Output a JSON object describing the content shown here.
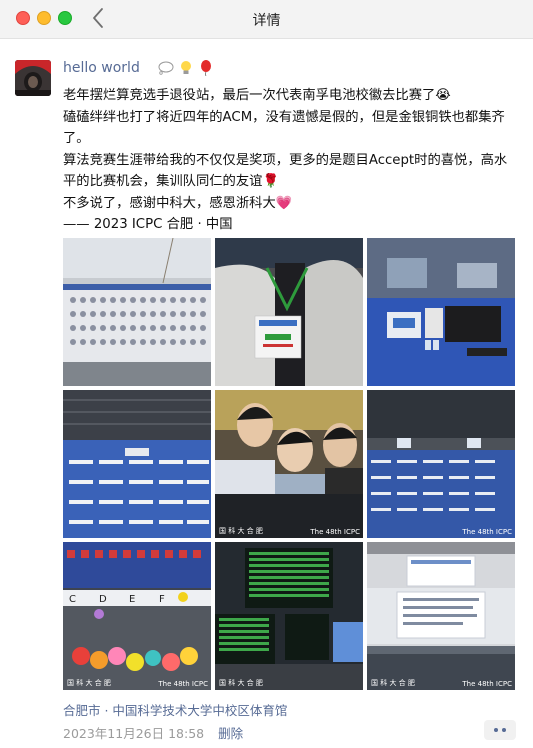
{
  "window": {
    "title": "详情"
  },
  "post": {
    "author": "hello world",
    "lines": [
      "老年摆烂算竞选手退役站，最后一次代表南孚电池校徽去比赛了😭",
      "磕磕绊绊也打了将近四年的ACM，没有遗憾是假的，但是金银铜铁也都集齐了。",
      "算法竞赛生涯带给我的不仅仅是奖项，更多的是题目Accept时的喜悦，高水平的比赛机会，集训队同仁的友谊🌹",
      "不多说了，感谢中科大，感恩浙科大💗",
      "—— 2023 ICPC 合肥 · 中国"
    ],
    "photo_watermark": "The 48th ICPC",
    "location": "合肥市 · 中国科学技术大学中校区体育馆",
    "timestamp": "2023年11月26日 18:58",
    "delete_label": "删除"
  },
  "icons": {
    "back": "chevron-left-icon",
    "author_emoji": [
      "speech-bubble-icon",
      "lightbulb-icon",
      "balloon-icon"
    ],
    "more": "more-dots-icon"
  },
  "colors": {
    "link": "#576b95",
    "meta": "#9b9b9b",
    "close": "#fe5f57",
    "minimize": "#febc2e",
    "zoom": "#28c840"
  }
}
